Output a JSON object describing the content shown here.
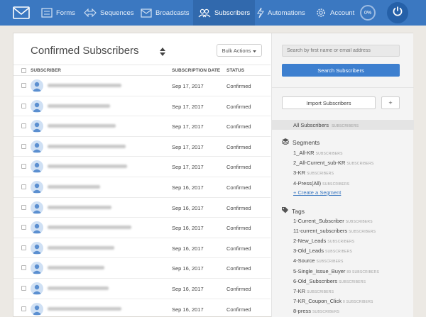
{
  "nav": {
    "items": [
      {
        "label": "Forms"
      },
      {
        "label": "Sequences"
      },
      {
        "label": "Broadcasts"
      },
      {
        "label": "Subscribers"
      },
      {
        "label": "Automations"
      },
      {
        "label": "Account"
      }
    ],
    "usage_badge": "0%",
    "active": "Subscribers"
  },
  "main": {
    "title": "Confirmed Subscribers",
    "bulk_actions_label": "Bulk Actions",
    "columns": {
      "subscriber": "SUBSCRIBER",
      "date": "SUBSCRIPTION DATE",
      "status": "STATUS"
    },
    "rows": [
      {
        "email": "",
        "date": "Sep 17, 2017",
        "status": "Confirmed"
      },
      {
        "email": "",
        "date": "Sep 17, 2017",
        "status": "Confirmed"
      },
      {
        "email": "",
        "date": "Sep 17, 2017",
        "status": "Confirmed"
      },
      {
        "email": "",
        "date": "Sep 17, 2017",
        "status": "Confirmed"
      },
      {
        "email": "",
        "date": "Sep 17, 2017",
        "status": "Confirmed"
      },
      {
        "email": "",
        "date": "Sep 16, 2017",
        "status": "Confirmed"
      },
      {
        "email": "",
        "date": "Sep 16, 2017",
        "status": "Confirmed"
      },
      {
        "email": "",
        "date": "Sep 16, 2017",
        "status": "Confirmed"
      },
      {
        "email": "",
        "date": "Sep 16, 2017",
        "status": "Confirmed"
      },
      {
        "email": "",
        "date": "Sep 16, 2017",
        "status": "Confirmed"
      },
      {
        "email": "",
        "date": "Sep 16, 2017",
        "status": "Confirmed"
      },
      {
        "email": "",
        "date": "Sep 16, 2017",
        "status": "Confirmed"
      }
    ]
  },
  "sidebar": {
    "search_placeholder": "Search by first name or email address",
    "search_button": "Search Subscribers",
    "import_button": "Import Subscribers",
    "add_button": "+",
    "all_subscribers": {
      "label": "All Subscribers",
      "count": "SUBSCRIBERS"
    },
    "segments_title": "Segments",
    "segments": [
      {
        "name": "1_All-KR",
        "count": "SUBSCRIBERS"
      },
      {
        "name": "2_All-Current_sub-KR",
        "count": "SUBSCRIBERS"
      },
      {
        "name": "3-KR",
        "count": "SUBSCRIBERS"
      },
      {
        "name": "4-Press(All)",
        "count": "SUBSCRIBERS"
      }
    ],
    "create_segment": "+ Create a Segment",
    "tags_title": "Tags",
    "tags": [
      {
        "name": "1-Current_Subscriber",
        "count": "SUBSCRIBERS"
      },
      {
        "name": "11-current_subscribers",
        "count": "SUBSCRIBERS"
      },
      {
        "name": "2-New_Leads",
        "count": "SUBSCRIBERS"
      },
      {
        "name": "3-Old_Leads",
        "count": "SUBSCRIBERS"
      },
      {
        "name": "4-Source",
        "count": "SUBSCRIBERS"
      },
      {
        "name": "5-Single_Issue_Buyer",
        "count": "89 SUBSCRIBERS"
      },
      {
        "name": "6-Old_Subscribers",
        "count": "SUBSCRIBERS"
      },
      {
        "name": "7-KR",
        "count": "SUBSCRIBERS"
      },
      {
        "name": "7-KR_Coupon_Click",
        "count": "0 SUBSCRIBERS"
      },
      {
        "name": "8-press",
        "count": "SUBSCRIBERS"
      }
    ]
  },
  "colors": {
    "nav_bg": "#3b78c1",
    "accent": "#3d7fcf",
    "background": "#ece9e4"
  }
}
